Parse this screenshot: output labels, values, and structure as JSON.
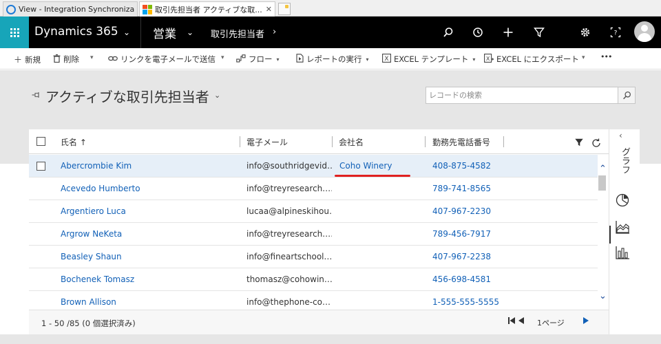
{
  "browser": {
    "tabs": [
      {
        "title": "View - Integration Synchroniza...",
        "icon": "ie-icon"
      },
      {
        "title": "取引先担当者 アクティブな取...",
        "icon": "microsoft-icon",
        "close": "✕"
      }
    ]
  },
  "nav": {
    "brand": "Dynamics 365",
    "area": "営業",
    "entity": "取引先担当者",
    "icons": [
      "search-icon",
      "recent-icon",
      "add-icon",
      "filter-icon",
      "settings-icon",
      "help-icon",
      "user-avatar"
    ]
  },
  "commands": {
    "new": "新規",
    "delete": "削除",
    "email_link": "リンクを電子メールで送信",
    "flow": "フロー",
    "run_report": "レポートの実行",
    "excel_template": "EXCEL テンプレート",
    "excel_export": "EXCEL にエクスポート",
    "more": "•••"
  },
  "view": {
    "title": "アクティブな取引先担当者",
    "search_placeholder": "レコードの検索"
  },
  "grid": {
    "columns": {
      "name": "氏名 ↑",
      "email": "電子メール",
      "company": "会社名",
      "phone": "勤務先電話番号"
    },
    "rows": [
      {
        "name": "Abercrombie Kim",
        "email": "info@southridgevid…",
        "company": "Coho Winery",
        "phone": "408-875-4582",
        "selected": true
      },
      {
        "name": "Acevedo Humberto",
        "email": "info@treyresearch.…",
        "company": "",
        "phone": "789-741-8565"
      },
      {
        "name": "Argentiero Luca",
        "email": "lucaa@alpineskihou…",
        "company": "",
        "phone": "407-967-2230"
      },
      {
        "name": "Argrow NeKeta",
        "email": "info@treyresearch.…",
        "company": "",
        "phone": "789-456-7917"
      },
      {
        "name": "Beasley Shaun",
        "email": "info@fineartschool.…",
        "company": "",
        "phone": "407-967-2238"
      },
      {
        "name": "Bochenek Tomasz",
        "email": "thomasz@cohowin…",
        "company": "",
        "phone": "456-698-4581"
      },
      {
        "name": "Brown Allison",
        "email": "info@thephone-co…",
        "company": "",
        "phone": "1-555-555-5555"
      }
    ],
    "footer_status": "1 - 50 /85 (0 個選択済み)",
    "page_label": "1ページ"
  },
  "side_panel": {
    "tab_label": "グラフ",
    "icons": [
      "pie-chart-icon",
      "area-chart-icon",
      "bar-chart-icon"
    ]
  },
  "colors": {
    "nav_bg": "#000000",
    "waffle_bg": "#17a5b9",
    "link": "#1160b7",
    "selected_row": "#e6eff8",
    "annotation_underline": "#e02020"
  }
}
